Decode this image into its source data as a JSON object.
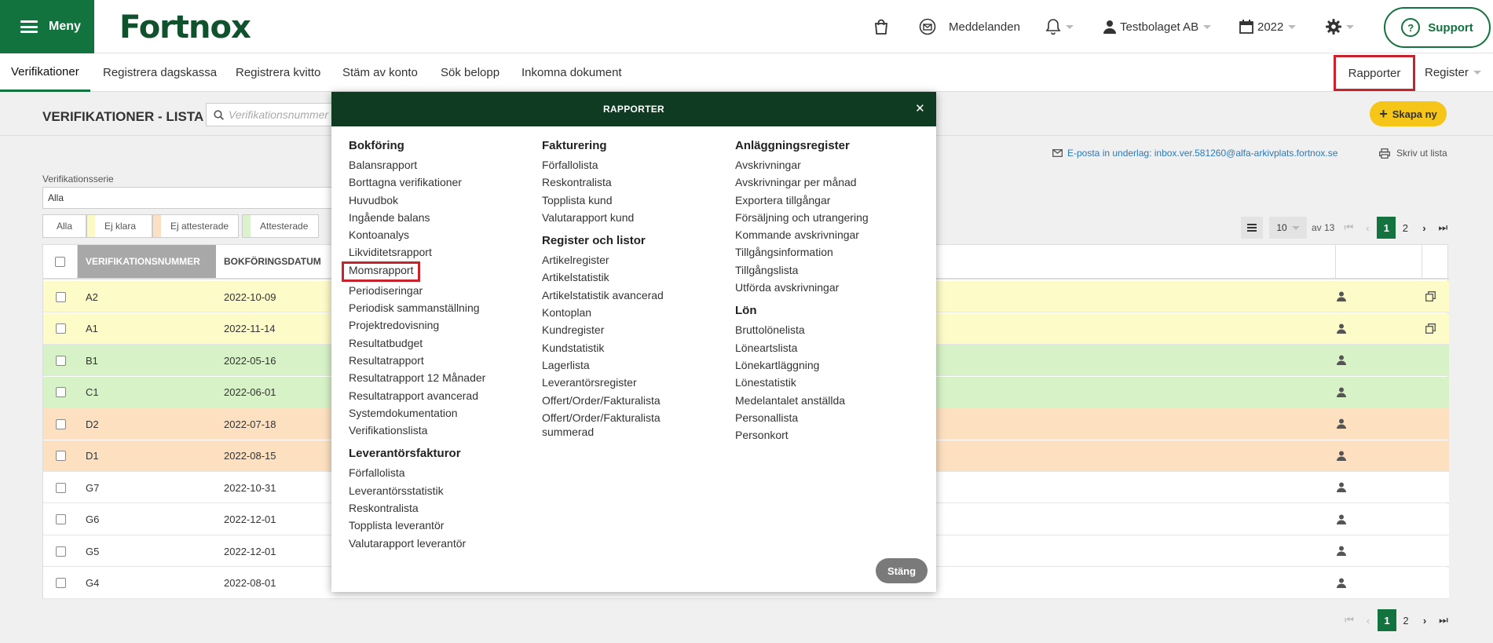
{
  "topbar": {
    "menu_label": "Meny",
    "logo_text": "Fortnox",
    "messages_label": "Meddelanden",
    "company_label": "Testbolaget AB",
    "year_label": "2022",
    "support_label": "Support"
  },
  "nav": {
    "tabs": [
      "Verifikationer",
      "Registrera dagskassa",
      "Registrera kvitto",
      "Stäm av konto",
      "Sök belopp",
      "Inkomna dokument"
    ],
    "rapporter_label": "Rapporter",
    "register_label": "Register"
  },
  "page": {
    "title": "VERIFIKATIONER - LISTA",
    "search_placeholder": "Verifikationsnummer",
    "create_label": "Skapa ny",
    "email_text": "E-posta in underlag: inbox.ver.581260@alfa-arkivplats.fortnox.se",
    "print_label": "Skriv ut lista",
    "series_label": "Verifikationsserie",
    "series_value": "Alla",
    "filters": [
      {
        "label": "Alla",
        "color": ""
      },
      {
        "label": "Ej klara",
        "color": "#fdf9c4"
      },
      {
        "label": "Ej attesterade",
        "color": "#fbe0c4"
      },
      {
        "label": "Attesterade",
        "color": "#dcf2cd"
      }
    ],
    "pager": {
      "page_size": "10",
      "of_text": "av 13",
      "pages": [
        "1",
        "2"
      ],
      "current": "1"
    }
  },
  "table": {
    "columns": [
      "VERIFIKATIONSNUMMER",
      "BOKFÖRINGSDATUM"
    ],
    "rows": [
      {
        "num": "A2",
        "date": "2022-10-09",
        "color": "#fdfbc8",
        "copy": true
      },
      {
        "num": "A1",
        "date": "2022-11-14",
        "color": "#fdfbc8",
        "copy": true
      },
      {
        "num": "B1",
        "date": "2022-05-16",
        "color": "#d7f2c6",
        "copy": false
      },
      {
        "num": "C1",
        "date": "2022-06-01",
        "color": "#d7f2c6",
        "copy": false
      },
      {
        "num": "D2",
        "date": "2022-07-18",
        "color": "#fce0c0",
        "copy": false
      },
      {
        "num": "D1",
        "date": "2022-08-15",
        "color": "#fce0c0",
        "copy": false
      },
      {
        "num": "G7",
        "date": "2022-10-31",
        "color": "#ffffff",
        "copy": false
      },
      {
        "num": "G6",
        "date": "2022-12-01",
        "color": "#ffffff",
        "copy": false
      },
      {
        "num": "G5",
        "date": "2022-12-01",
        "color": "#ffffff",
        "copy": false
      },
      {
        "num": "G4",
        "date": "2022-08-01",
        "color": "#ffffff",
        "copy": false
      }
    ]
  },
  "modal": {
    "title": "RAPPORTER",
    "close_label": "Stäng",
    "columns": [
      {
        "sections": [
          {
            "heading": "Bokföring",
            "items": [
              "Balansrapport",
              "Borttagna verifikationer",
              "Huvudbok",
              "Ingående balans",
              "Kontoanalys",
              "Likviditetsrapport",
              "Momsrapport",
              "Periodiseringar",
              "Periodisk sammanställning",
              "Projektredovisning",
              "Resultatbudget",
              "Resultatrapport",
              "Resultatrapport 12 Månader",
              "Resultatrapport avancerad",
              "Systemdokumentation",
              "Verifikationslista"
            ]
          },
          {
            "heading": "Leverantörsfakturor",
            "items": [
              "Förfallolista",
              "Leverantörsstatistik",
              "Reskontralista",
              "Topplista leverantör",
              "Valutarapport leverantör"
            ]
          }
        ]
      },
      {
        "sections": [
          {
            "heading": "Fakturering",
            "items": [
              "Förfallolista",
              "Reskontralista",
              "Topplista kund",
              "Valutarapport kund"
            ]
          },
          {
            "heading": "Register och listor",
            "items": [
              "Artikelregister",
              "Artikelstatistik",
              "Artikelstatistik avancerad",
              "Kontoplan",
              "Kundregister",
              "Kundstatistik",
              "Lagerlista",
              "Leverantörsregister",
              "Offert/Order/Fakturalista",
              "Offert/Order/Fakturalista summerad"
            ]
          }
        ]
      },
      {
        "sections": [
          {
            "heading": "Anläggningsregister",
            "items": [
              "Avskrivningar",
              "Avskrivningar per månad",
              "Exportera tillgångar",
              "Försäljning och utrangering",
              "Kommande avskrivningar",
              "Tillgångsinformation",
              "Tillgångslista",
              "Utförda avskrivningar"
            ]
          },
          {
            "heading": "Lön",
            "items": [
              "Bruttolönelista",
              "Löneartslista",
              "Lönekartläggning",
              "Lönestatistik",
              "Medelantalet anställda",
              "Personallista",
              "Personkort"
            ]
          }
        ]
      }
    ],
    "highlighted_item": "Momsrapport"
  },
  "colors": {
    "brand_green": "#12733e",
    "dark_green": "#0e3b22",
    "highlight_red": "#c8232c",
    "accent_yellow": "#f5c518"
  }
}
